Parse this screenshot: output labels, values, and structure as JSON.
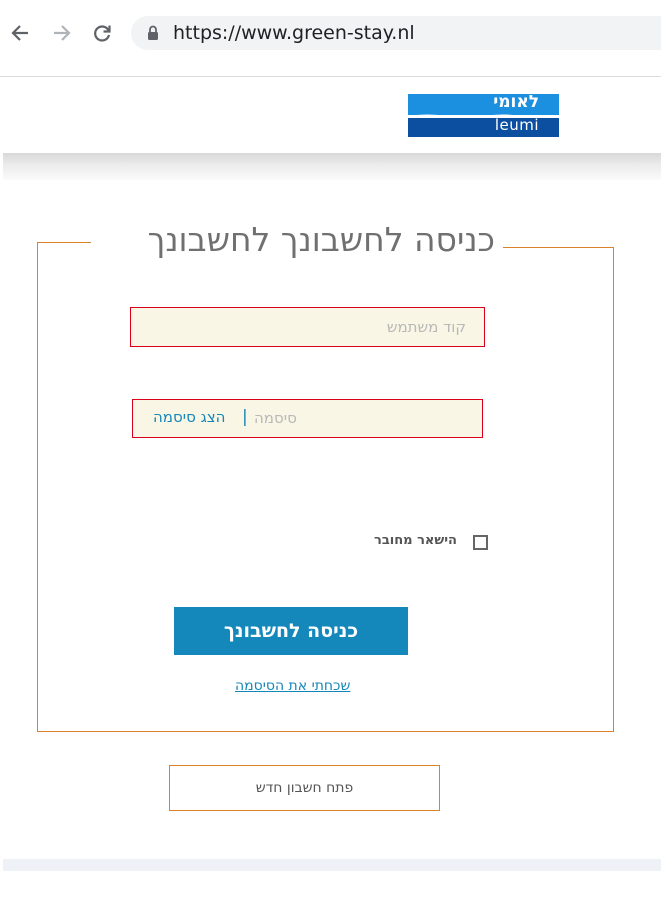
{
  "browser": {
    "url": "https://www.green-stay.nl",
    "back_icon": "arrow-left-icon",
    "forward_icon": "arrow-right-icon",
    "reload_icon": "reload-icon",
    "lock_icon": "lock-icon"
  },
  "logo": {
    "hebrew": "לאומי",
    "english": "leumi",
    "colors": {
      "top": "#1b8fe0",
      "bottom": "#0c4fa0"
    }
  },
  "login": {
    "title": "כניסה לחשבונך לחשבונך",
    "username_placeholder": "קוד משתמש",
    "password_placeholder": "סיסמה",
    "password_separator": "|",
    "show_password": "הצג סיסמה",
    "remember_label": "הישאר מחובר",
    "remember_checked": false,
    "submit_label": "כניסה לחשבונך",
    "forgot_password": "שכחתי את הסיסמה"
  },
  "open_account_label": "פתח חשבון חדש",
  "colors": {
    "accent": "#1488bb",
    "border": "#d9822b",
    "field_error": "#d9001b",
    "field_bg": "#faf6e5"
  }
}
